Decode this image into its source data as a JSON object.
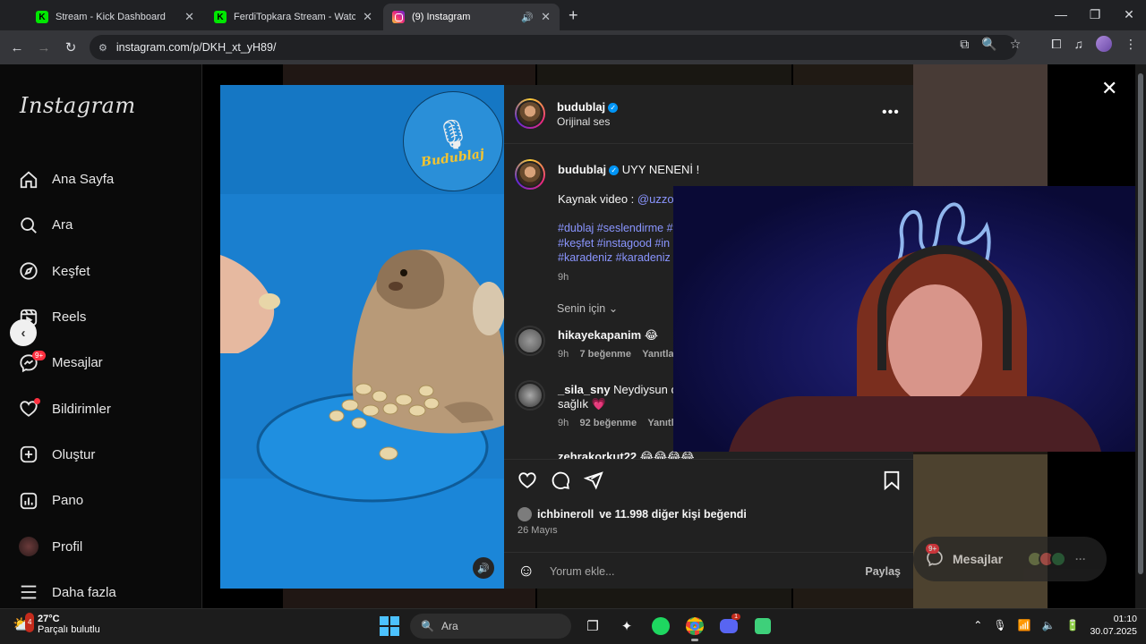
{
  "browser": {
    "tabs": [
      {
        "title": "Stream - Kick Dashboard",
        "favicon": "kick",
        "active": false
      },
      {
        "title": "FerdiTopkara Stream - Watch Live",
        "favicon": "kick",
        "active": false
      },
      {
        "title": "(9) Instagram",
        "favicon": "instagram",
        "active": true
      }
    ],
    "url": "instagram.com/p/DKH_xt_yH89/"
  },
  "sidebar": {
    "logo": "Instagram",
    "items": [
      {
        "label": "Ana Sayfa",
        "icon": "home-icon"
      },
      {
        "label": "Ara",
        "icon": "search-icon"
      },
      {
        "label": "Keşfet",
        "icon": "compass-icon"
      },
      {
        "label": "Reels",
        "icon": "reels-icon"
      },
      {
        "label": "Mesajlar",
        "icon": "messenger-icon",
        "badge": "9+"
      },
      {
        "label": "Bildirimler",
        "icon": "heart-icon",
        "dot": true
      },
      {
        "label": "Oluştur",
        "icon": "plus-square-icon"
      },
      {
        "label": "Pano",
        "icon": "chart-icon"
      },
      {
        "label": "Profil",
        "icon": "profile-avatar-icon"
      },
      {
        "label": "Daha fazla",
        "icon": "menu-icon"
      }
    ]
  },
  "media": {
    "watermark": "Budublaj"
  },
  "post": {
    "author": "budublaj",
    "audio": "Orijinal ses",
    "caption_author": "budublaj",
    "caption": "UYY NENENİ !",
    "source_label": "Kaynak video :",
    "source_handle": "@uzzola",
    "tags_line1": "#dublaj #seslendirme #",
    "tags_line2": "#keşfet #instagood #in",
    "tags_line3": "#karadeniz #karadeniz",
    "caption_time": "9h",
    "filter": "Senin için",
    "comments": [
      {
        "user": "hikayekapanim",
        "text": "😂",
        "time": "9h",
        "likes": "7 beğenme",
        "reply": "Yanıtla"
      },
      {
        "user": "_sila_sny",
        "text": "Neydiysun oy",
        "text2": "sağlık 💗",
        "time": "9h",
        "likes": "92 beğenme",
        "reply": "Yanıtla"
      },
      {
        "user": "zehrakorkut22",
        "text": "😂😂😂😂"
      }
    ],
    "liked_by_user": "ichbineroll",
    "liked_by_rest": "ve 11.998 diğer kişi beğendi",
    "date": "26 Mayıs",
    "comment_placeholder": "Yorum ekle...",
    "share_label": "Paylaş"
  },
  "messages_pill": {
    "label": "Mesajlar",
    "badge": "9+"
  },
  "taskbar": {
    "temp": "27°C",
    "weather": "Parçalı bulutlu",
    "weather_badge": "4",
    "search": "Ara",
    "discord_badge": "1",
    "time": "01:10",
    "date": "30.07.2025"
  },
  "colors": {
    "accent": "#0095f6",
    "notification": "#ff3040",
    "hashtag": "#8a95ff"
  }
}
